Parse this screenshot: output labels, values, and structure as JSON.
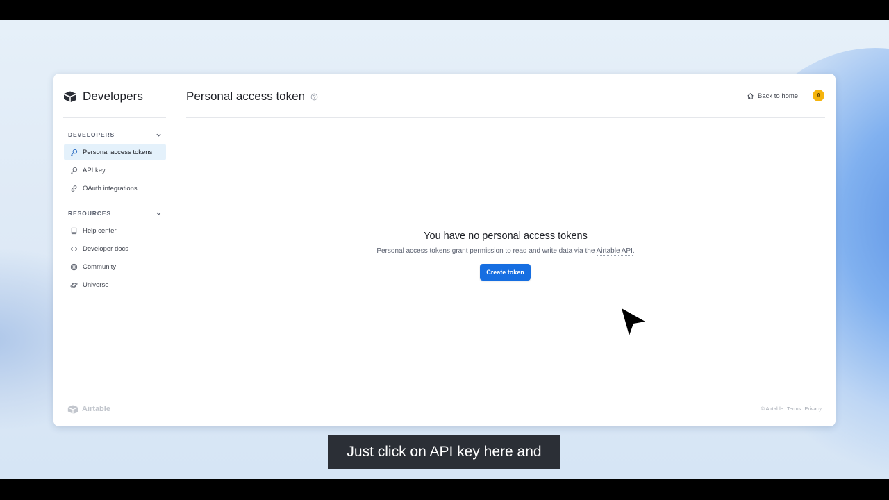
{
  "sidebar": {
    "brand": "Developers",
    "sections": [
      {
        "title": "DEVELOPERS",
        "items": [
          {
            "label": "Personal access tokens",
            "icon": "key-icon",
            "active": true
          },
          {
            "label": "API key",
            "icon": "key-icon",
            "active": false
          },
          {
            "label": "OAuth integrations",
            "icon": "link-icon",
            "active": false
          }
        ]
      },
      {
        "title": "RESOURCES",
        "items": [
          {
            "label": "Help center",
            "icon": "book-icon"
          },
          {
            "label": "Developer docs",
            "icon": "code-icon"
          },
          {
            "label": "Community",
            "icon": "globe-icon"
          },
          {
            "label": "Universe",
            "icon": "planet-icon"
          }
        ]
      }
    ]
  },
  "header": {
    "title": "Personal access token",
    "back_label": "Back to home",
    "avatar_initial": "A"
  },
  "empty_state": {
    "title": "You have no personal access tokens",
    "description_prefix": "Personal access tokens grant permission to read and write data via the ",
    "description_link": "Airtable API",
    "description_suffix": ".",
    "button_label": "Create token"
  },
  "footer": {
    "logo_text": "Airtable",
    "copyright": "© Airtable",
    "terms": "Terms",
    "privacy": "Privacy"
  },
  "caption": "Just click on API key here and",
  "colors": {
    "accent": "#166ee1",
    "active_item_bg": "#e4f1fb",
    "avatar": "#f5b40c"
  }
}
